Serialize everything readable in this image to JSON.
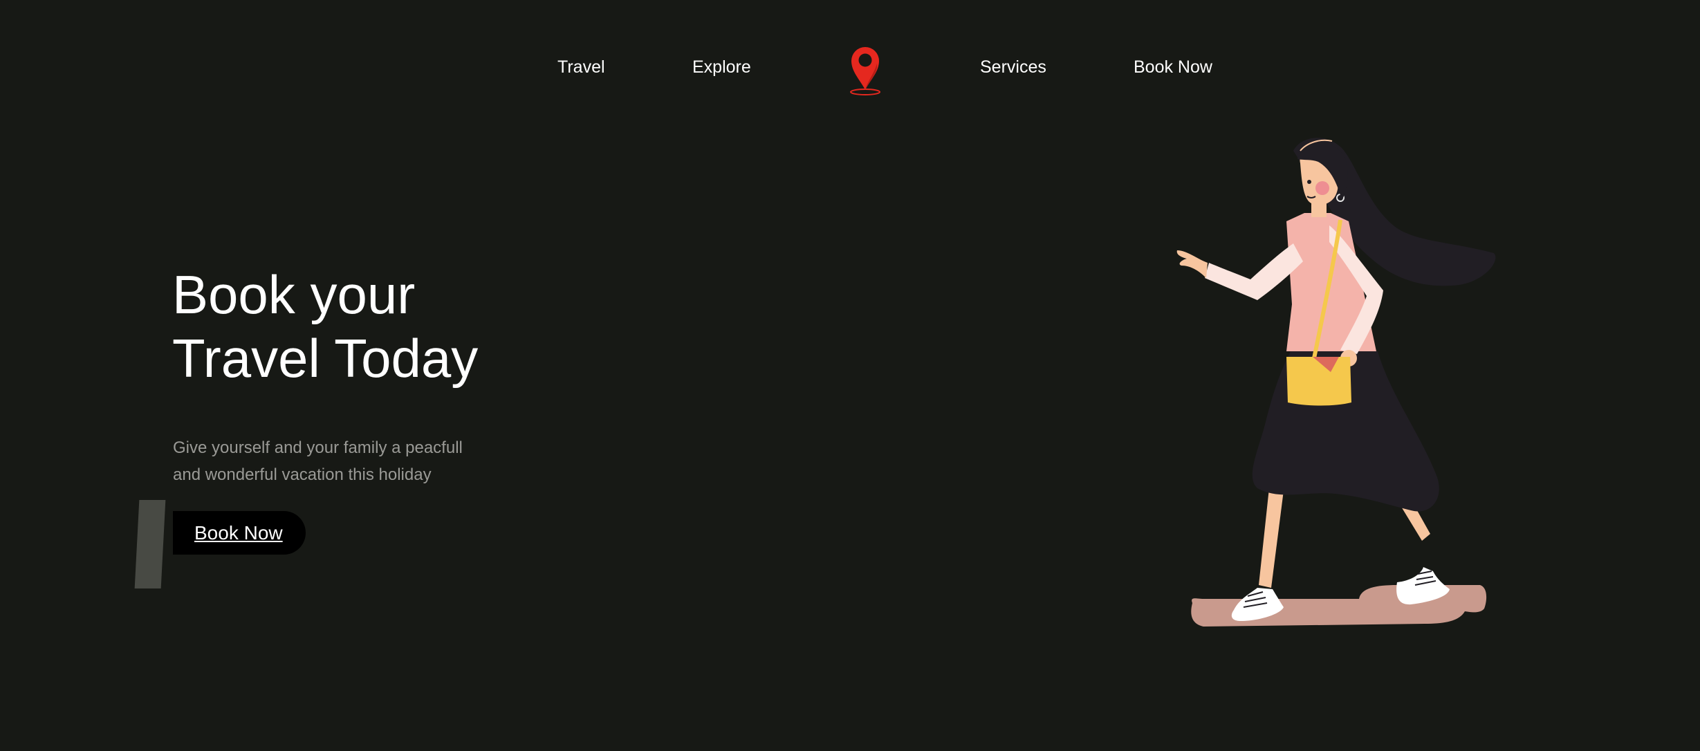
{
  "nav": {
    "items": [
      {
        "label": "Travel"
      },
      {
        "label": "Explore"
      },
      {
        "label": "Services"
      },
      {
        "label": "Book Now"
      }
    ],
    "logo_icon": "map-pin-icon"
  },
  "hero": {
    "title_line1": "Book your",
    "title_line2": "Travel Today",
    "subtitle_line1": "Give yourself and your family a peacfull",
    "subtitle_line2": "and wonderful vacation this holiday",
    "cta_label": "Book Now"
  },
  "illustration": {
    "icon": "walking-woman-illustration"
  },
  "colors": {
    "background": "#171915",
    "text": "#ffffff",
    "subtitle": "#9a9a96",
    "pin": "#e5281f",
    "accent_bar": "#484a44",
    "button": "#000000"
  }
}
